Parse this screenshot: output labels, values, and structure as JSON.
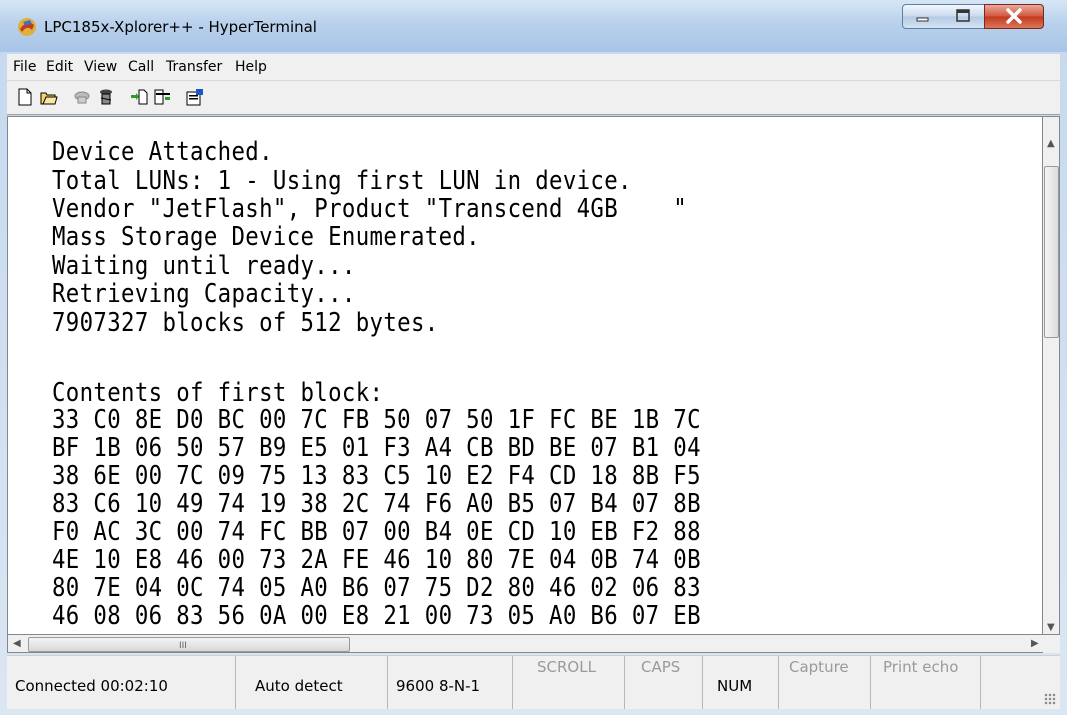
{
  "window": {
    "title": "LPC185x-Xplorer++ - HyperTerminal"
  },
  "menu": [
    "File",
    "Edit",
    "View",
    "Call",
    "Transfer",
    "Help"
  ],
  "toolbar": [
    "new-icon",
    "open-icon",
    "phone-icon",
    "disconnect-icon",
    "send-icon",
    "receive-icon",
    "properties-icon"
  ],
  "terminal": {
    "lines": [
      "Device Attached.",
      "Total LUNs: 1 - Using first LUN in device.",
      "Vendor \"JetFlash\", Product \"Transcend 4GB    \"",
      "Mass Storage Device Enumerated.",
      "Waiting until ready...",
      "Retrieving Capacity...",
      "7907327 blocks of 512 bytes.",
      "",
      "Contents of first block:",
      "33 C0 8E D0 BC 00 7C FB 50 07 50 1F FC BE 1B 7C",
      "BF 1B 06 50 57 B9 E5 01 F3 A4 CB BD BE 07 B1 04",
      "38 6E 00 7C 09 75 13 83 C5 10 E2 F4 CD 18 8B F5",
      "83 C6 10 49 74 19 38 2C 74 F6 A0 B5 07 B4 07 8B",
      "F0 AC 3C 00 74 FC BB 07 00 B4 0E CD 10 EB F2 88",
      "4E 10 E8 46 00 73 2A FE 46 10 80 7E 04 0B 74 0B",
      "80 7E 04 0C 74 05 A0 B6 07 75 D2 80 46 02 06 83",
      "46 08 06 83 56 0A 00 E8 21 00 73 05 A0 B6 07 EB"
    ]
  },
  "status": {
    "connected": "Connected 00:02:10",
    "detect": "Auto detect",
    "settings": "9600 8-N-1",
    "scroll": "SCROLL",
    "caps": "CAPS",
    "num": "NUM",
    "capture": "Capture",
    "print_echo": "Print echo"
  },
  "scrollbar": {
    "grip": "III"
  }
}
